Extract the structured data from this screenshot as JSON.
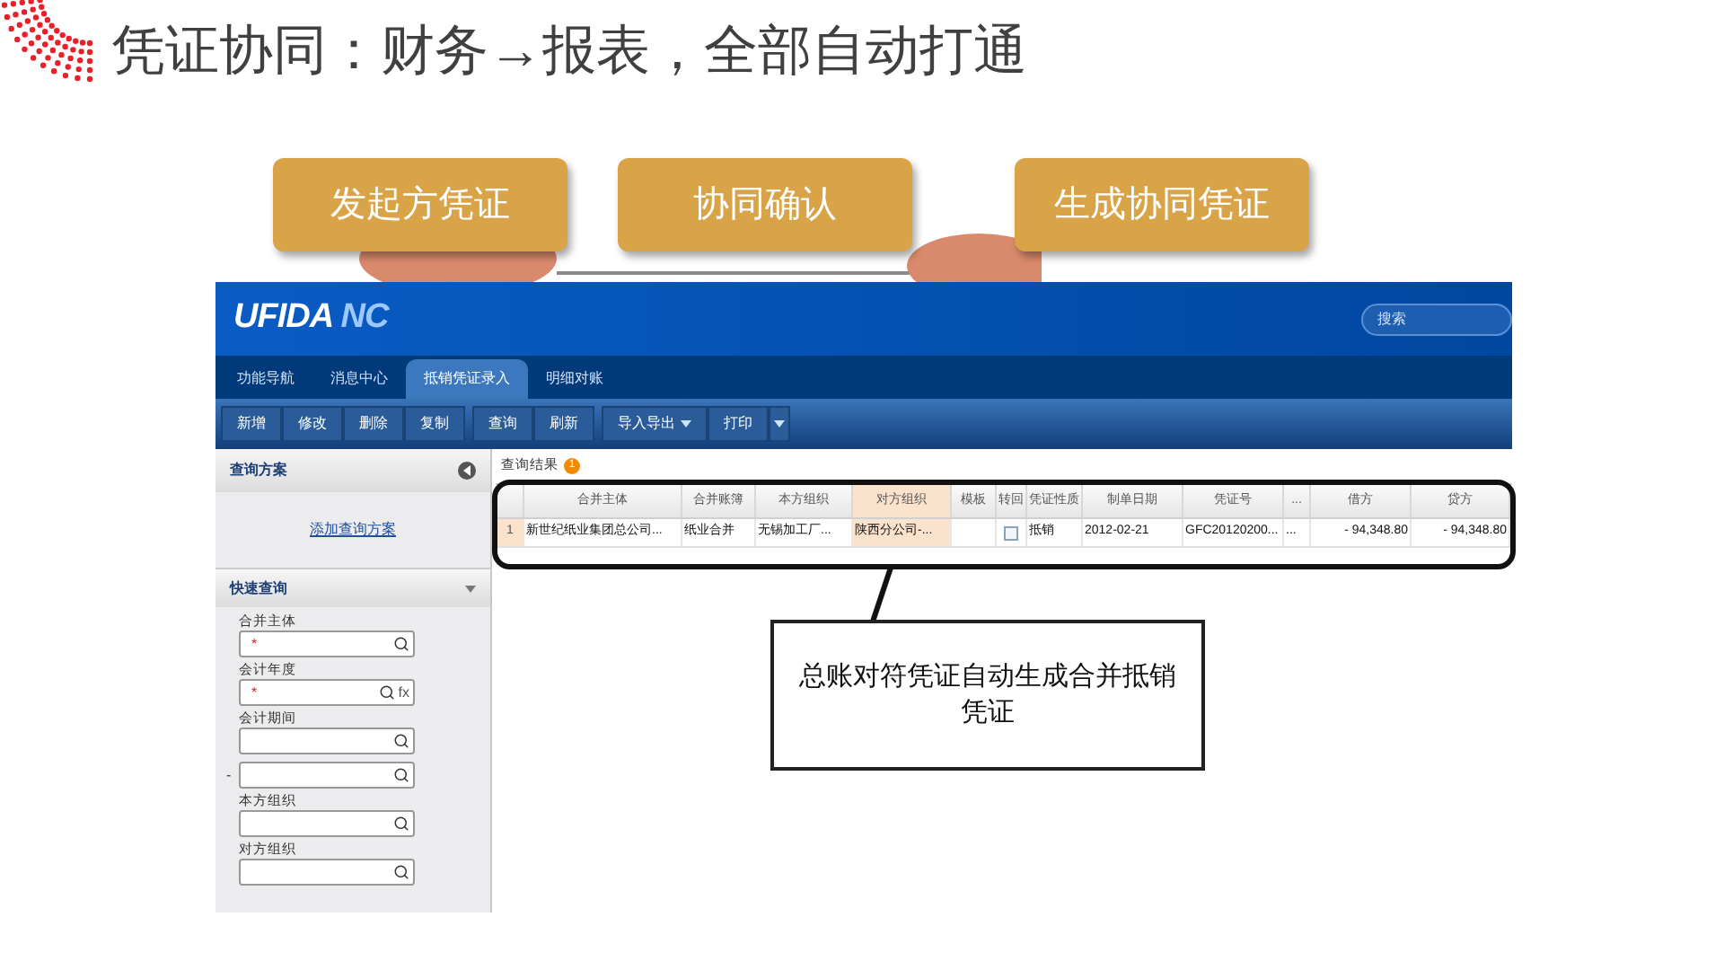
{
  "slide": {
    "title": "凭证协同：财务→报表，全部自动打通"
  },
  "flow_steps": [
    "发起方凭证",
    "协同确认",
    "生成协同凭证"
  ],
  "app": {
    "logo": {
      "text": "UFIDA",
      "suffix": "NC"
    },
    "search": {
      "placeholder": "搜索"
    },
    "tabs": [
      {
        "label": "功能导航",
        "selected": false
      },
      {
        "label": "消息中心",
        "selected": false
      },
      {
        "label": "抵销凭证录入",
        "selected": true
      },
      {
        "label": "明细对账",
        "selected": false
      }
    ],
    "toolbar_groups": [
      [
        {
          "label": "新增",
          "kind": "button"
        },
        {
          "label": "修改",
          "kind": "button"
        },
        {
          "label": "删除",
          "kind": "button"
        },
        {
          "label": "复制",
          "kind": "button"
        }
      ],
      [
        {
          "label": "查询",
          "kind": "button"
        },
        {
          "label": "刷新",
          "kind": "button"
        }
      ],
      [
        {
          "label": "导入导出",
          "kind": "dropdown"
        },
        {
          "label": "打印",
          "kind": "split"
        }
      ]
    ],
    "query_panel": {
      "title": "查询方案",
      "link": "添加查询方案"
    },
    "quick_panel": {
      "title": "快速查询",
      "fields": [
        {
          "label": "合并主体",
          "required": "*"
        },
        {
          "label": "会计年度",
          "required": "*",
          "fx": "fx"
        },
        {
          "label": "会计期间"
        },
        {
          "prefix": "-"
        },
        {
          "label": "本方组织"
        },
        {
          "label": "对方组织"
        }
      ]
    },
    "results": {
      "title": "查询结果",
      "badge": "1",
      "columns": [
        {
          "label": "合并主体",
          "highlighted": false
        },
        {
          "label": "合并账簿",
          "highlighted": false
        },
        {
          "label": "本方组织",
          "highlighted": false
        },
        {
          "label": "对方组织",
          "highlighted": true
        },
        {
          "label": "模板",
          "highlighted": false
        },
        {
          "label": "转回",
          "highlighted": false
        },
        {
          "label": "凭证性质",
          "highlighted": false
        },
        {
          "label": "制单日期",
          "highlighted": false
        },
        {
          "label": "凭证号",
          "highlighted": false
        },
        {
          "label": "...",
          "highlighted": false
        },
        {
          "label": "借方",
          "highlighted": false
        },
        {
          "label": "贷方",
          "highlighted": false
        }
      ],
      "rows": [
        {
          "index": "1",
          "cells": [
            "新世纪纸业集团总公司...",
            "纸业合并",
            "无锡加工厂...",
            "陕西分公司-...",
            "",
            {
              "checked": false
            },
            "抵销",
            "2012-02-21",
            "GFC20120200...",
            "...",
            "- 94,348.80",
            "- 94,348.80"
          ]
        }
      ]
    }
  },
  "callout": "总账对符凭证自动生成合并抵销凭证"
}
